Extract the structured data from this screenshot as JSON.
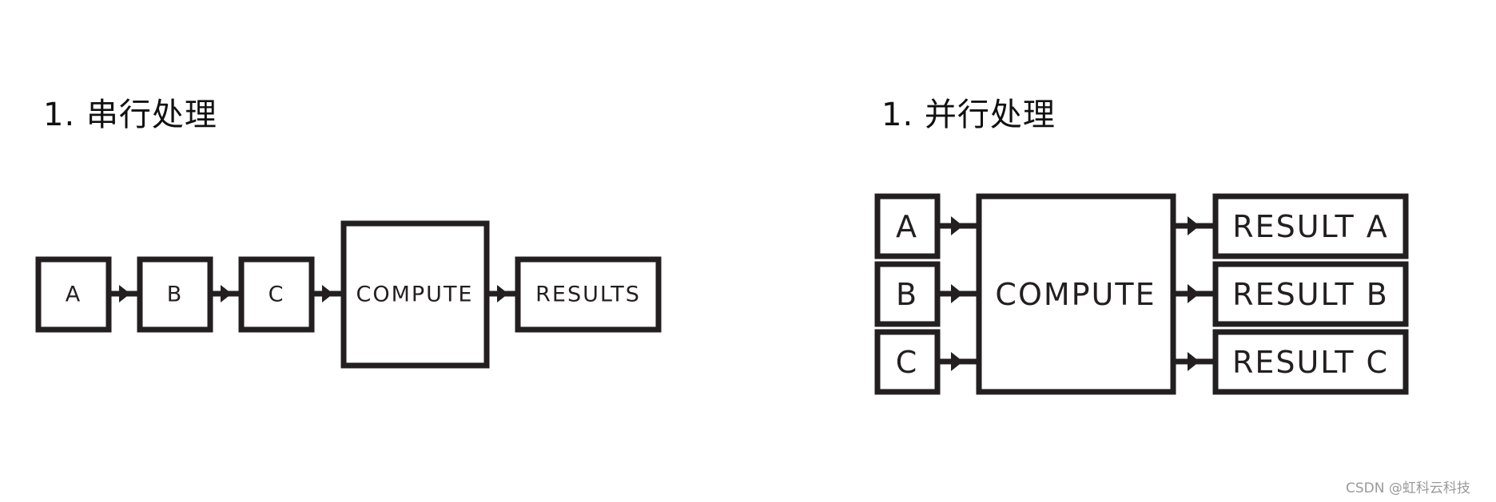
{
  "serial": {
    "title": "1. 串行处理",
    "inputs": [
      "A",
      "B",
      "C"
    ],
    "compute_label": "COMPUTE",
    "result_label": "RESULTS"
  },
  "parallel": {
    "title": "1. 并行处理",
    "inputs": [
      "A",
      "B",
      "C"
    ],
    "compute_label": "COMPUTE",
    "results": [
      "RESULT A",
      "RESULT B",
      "RESULT C"
    ]
  },
  "colors": {
    "stroke": "#231f20",
    "background": "#ffffff",
    "watermark": "#9a9a9a"
  },
  "watermark": "CSDN @虹科云科技"
}
